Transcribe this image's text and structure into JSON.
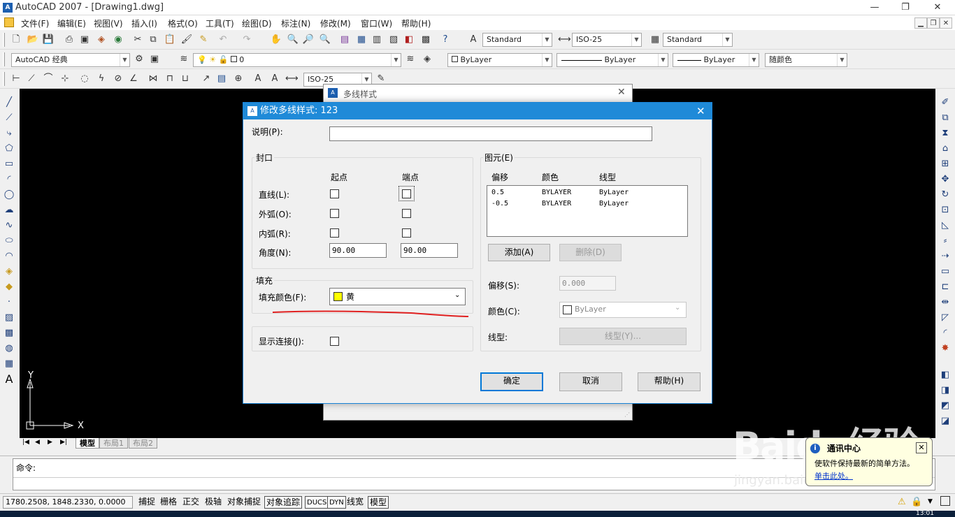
{
  "window": {
    "title": "AutoCAD 2007 - [Drawing1.dwg]",
    "min": "—",
    "restore": "❐",
    "close": "✕"
  },
  "menu": [
    "文件(F)",
    "编辑(E)",
    "视图(V)",
    "插入(I)",
    "格式(O)",
    "工具(T)",
    "绘图(D)",
    "标注(N)",
    "修改(M)",
    "窗口(W)",
    "帮助(H)"
  ],
  "styles_toolbar": {
    "text_style": "Standard",
    "dim_style": "ISO-25",
    "table_style": "Standard"
  },
  "workspace": {
    "name": "AutoCAD 经典"
  },
  "layers": {
    "current": "0"
  },
  "properties": {
    "color": "ByLayer",
    "linetype": "ByLayer",
    "lineweight": "ByLayer",
    "plotstyle": "随颜色"
  },
  "dim_toolbar": {
    "dim_style": "ISO-25"
  },
  "ucs": {
    "y": "Y",
    "x": "X"
  },
  "layout_tabs": [
    "模型",
    "布局1",
    "布局2"
  ],
  "command": {
    "prompt": "命令:"
  },
  "status": {
    "coords": "1780.2508, 1848.2330, 0.0000",
    "buttons": [
      "捕捉",
      "栅格",
      "正交",
      "极轴",
      "对象捕捉",
      "对象追踪",
      "DUCS",
      "DYN",
      "线宽",
      "模型"
    ],
    "time": "13:01"
  },
  "bg_dialog": {
    "title": "多线样式"
  },
  "dialog": {
    "title": "修改多线样式: 123",
    "description_label": "说明(P):",
    "description_value": "",
    "caps": {
      "group": "封口",
      "start_header": "起点",
      "end_header": "端点",
      "rows": [
        {
          "label": "直线(L):",
          "start": false,
          "end": false
        },
        {
          "label": "外弧(O):",
          "start": false,
          "end": false
        },
        {
          "label": "内弧(R):",
          "start": false,
          "end": false
        }
      ],
      "angle_label": "角度(N):",
      "angle_start": "90.00",
      "angle_end": "90.00"
    },
    "fill": {
      "group": "填充",
      "color_label": "填充颜色(F):",
      "color_value": "黄",
      "swatch": "#ffff00"
    },
    "show_joints": {
      "label": "显示连接(J):",
      "checked": false
    },
    "elements": {
      "group": "图元(E)",
      "headers": [
        "偏移",
        "颜色",
        "线型"
      ],
      "rows": [
        {
          "offset": "0.5",
          "color": "BYLAYER",
          "linetype": "ByLayer"
        },
        {
          "offset": "-0.5",
          "color": "BYLAYER",
          "linetype": "ByLayer"
        }
      ],
      "add": "添加(A)",
      "delete": "删除(D)",
      "offset_label": "偏移(S):",
      "offset_value": "0.000",
      "color_label": "颜色(C):",
      "color_value": "ByLayer",
      "linetype_label": "线型:",
      "linetype_button": "线型(Y)..."
    },
    "ok": "确定",
    "cancel": "取消",
    "help": "帮助(H)"
  },
  "watermark": {
    "text": "Baidu经验",
    "url": "jingyan.baidu.com"
  },
  "balloon": {
    "title": "通讯中心",
    "text": "使软件保持最新的简单方法。",
    "link": "单击此处。"
  },
  "colors": {
    "accent": "#1f8ad8",
    "drawing_bg": "#000000",
    "annotation": "#e02020"
  }
}
